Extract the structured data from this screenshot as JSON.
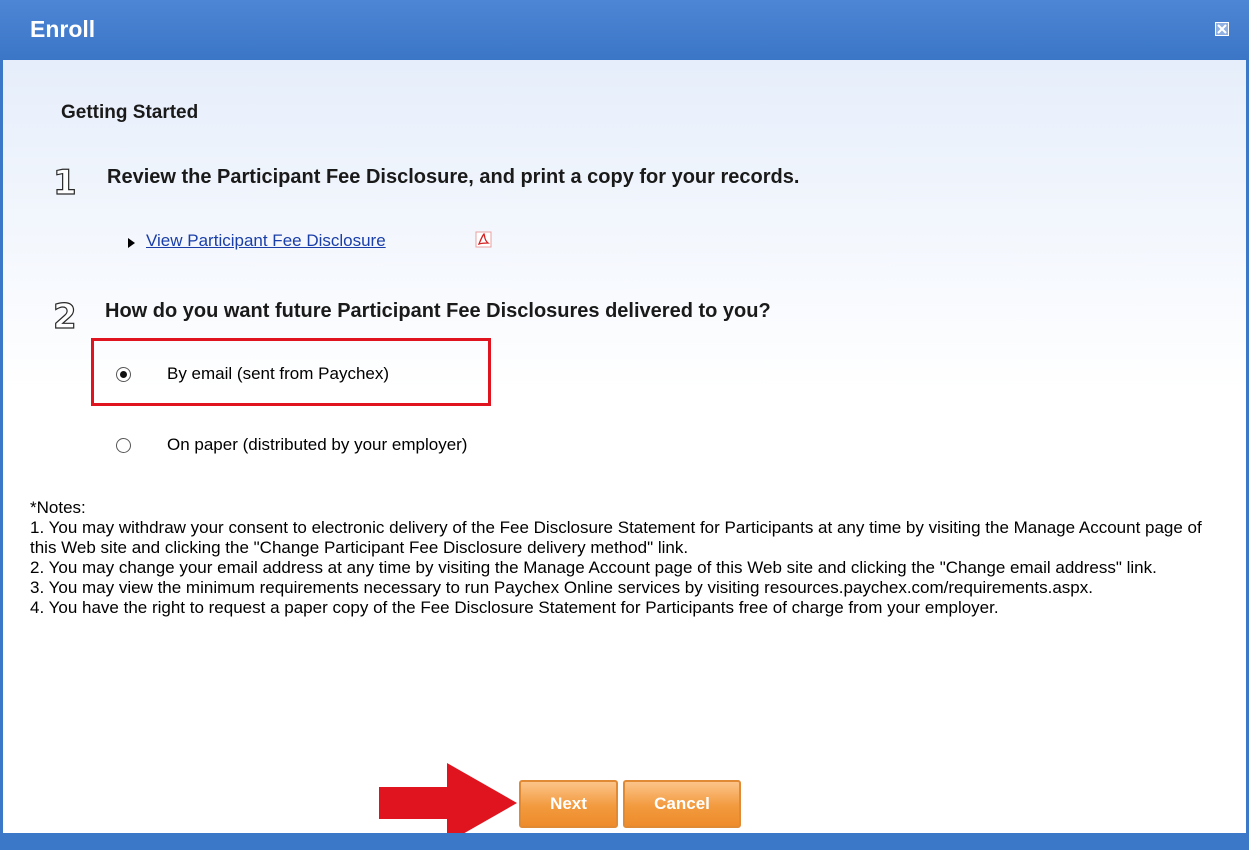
{
  "dialog": {
    "title": "Enroll",
    "close_icon": "close-icon"
  },
  "content": {
    "heading": "Getting Started",
    "step1": {
      "number": "1",
      "text": "Review the Participant Fee Disclosure, and print a copy for your records.",
      "link_label": "View Participant Fee Disclosure",
      "link_icon": "pdf-icon"
    },
    "step2": {
      "number": "2",
      "text": "How do you want future Participant Fee Disclosures delivered to you?",
      "options": [
        {
          "label": "By email (sent from Paychex)",
          "selected": true
        },
        {
          "label": "On paper (distributed by your employer)",
          "selected": false
        }
      ]
    },
    "notes": {
      "heading": "*Notes:",
      "items": [
        "1. You may withdraw your consent to electronic delivery of the Fee Disclosure Statement for Participants at any time by visiting the Manage Account page of this Web site and clicking the \"Change Participant Fee Disclosure delivery method\" link.",
        "2. You may change your email address at any time by visiting the Manage Account page of this Web site and clicking the \"Change email address\" link.",
        "3. You may view the minimum requirements necessary to run Paychex Online services by visiting resources.paychex.com/requirements.aspx.",
        "4. You have the right to request a paper copy of the Fee Disclosure Statement for Participants free of charge from your employer."
      ]
    }
  },
  "buttons": {
    "next": "Next",
    "cancel": "Cancel"
  },
  "colors": {
    "titlebar": "#3c78c8",
    "highlight": "#e0141e",
    "button": "#f29a3e",
    "arrow": "#e0141e"
  }
}
